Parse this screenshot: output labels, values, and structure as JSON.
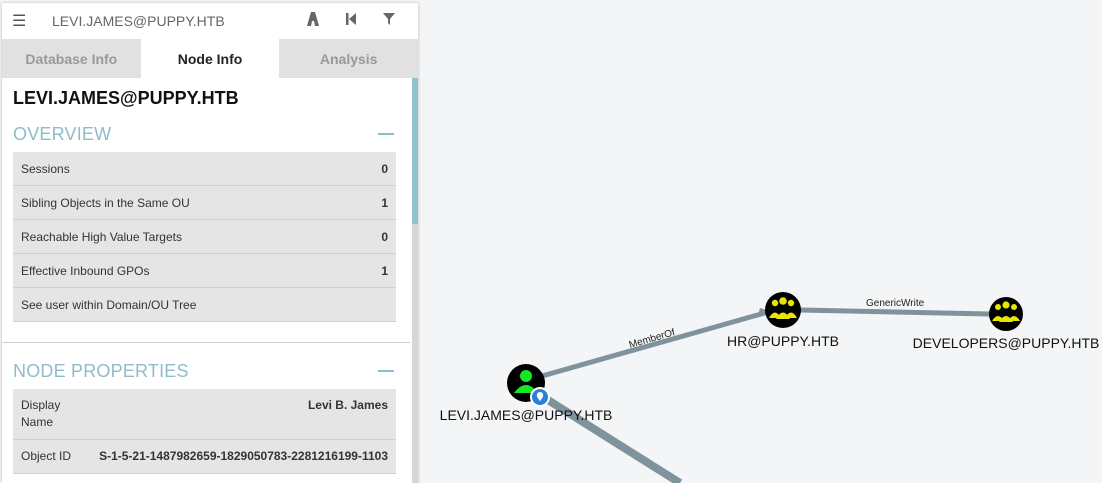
{
  "search": {
    "text": "LEVI.JAMES@PUPPY.HTB"
  },
  "tabs": [
    {
      "label": "Database Info",
      "active": false
    },
    {
      "label": "Node Info",
      "active": true
    },
    {
      "label": "Analysis",
      "active": false
    }
  ],
  "node": {
    "title": "LEVI.JAMES@PUPPY.HTB"
  },
  "overview": {
    "title": "OVERVIEW",
    "rows": [
      {
        "label": "Sessions",
        "value": "0"
      },
      {
        "label": "Sibling Objects in the Same OU",
        "value": "1"
      },
      {
        "label": "Reachable High Value Targets",
        "value": "0"
      },
      {
        "label": "Effective Inbound GPOs",
        "value": "1"
      },
      {
        "label": "See user within Domain/OU Tree",
        "value": ""
      }
    ]
  },
  "properties": {
    "title": "NODE PROPERTIES",
    "rows": [
      {
        "label": "Display Name",
        "value": "Levi B. James"
      },
      {
        "label": "Object ID",
        "value": "S-1-5-21-1487982659-1829050783-2281216199-1103"
      }
    ]
  },
  "graph": {
    "nodes": [
      {
        "label": "LEVI.JAMES@PUPPY.HTB",
        "kind": "user",
        "owned": true
      },
      {
        "label": "HR@PUPPY.HTB",
        "kind": "group"
      },
      {
        "label": "DEVELOPERS@PUPPY.HTB",
        "kind": "group"
      }
    ],
    "edges": [
      {
        "label": "MemberOf"
      },
      {
        "label": "GenericWrite"
      }
    ]
  },
  "colors": {
    "accent": "#8fbcc8",
    "group_icon": "#e6e600",
    "user_icon": "#17e625",
    "node_fill": "#000000",
    "edge": "#7f939c"
  }
}
